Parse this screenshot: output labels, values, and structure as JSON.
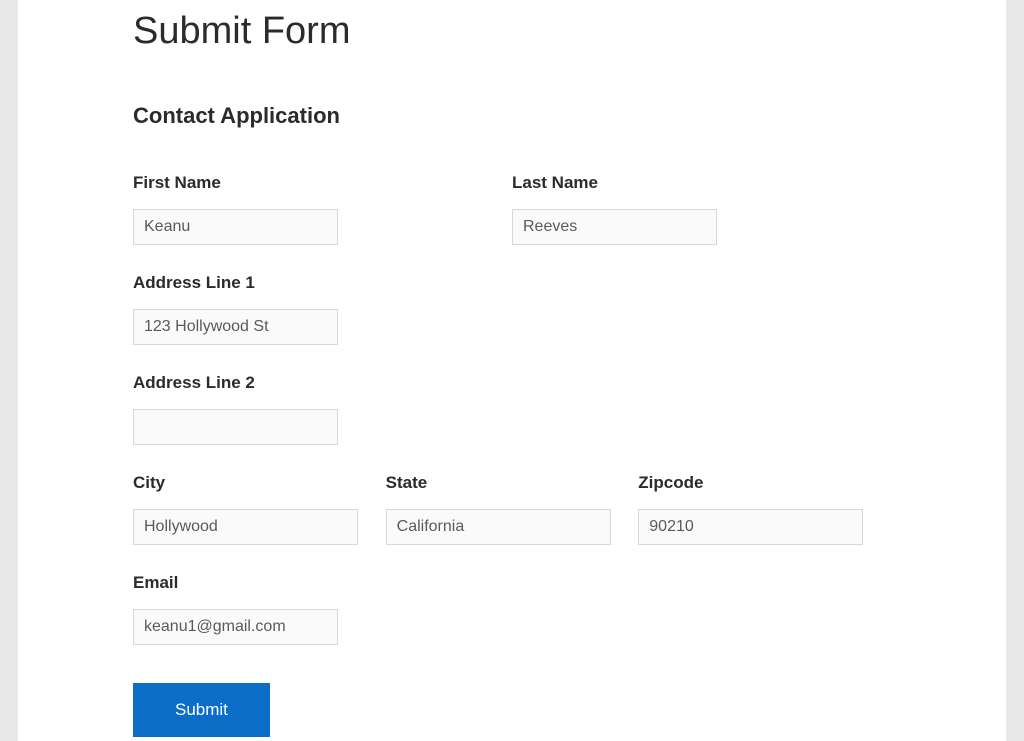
{
  "page": {
    "title": "Submit Form",
    "section_title": "Contact Application"
  },
  "form": {
    "first_name": {
      "label": "First Name",
      "value": "Keanu"
    },
    "last_name": {
      "label": "Last Name",
      "value": "Reeves"
    },
    "address_line_1": {
      "label": "Address Line 1",
      "value": "123 Hollywood St"
    },
    "address_line_2": {
      "label": "Address Line 2",
      "value": ""
    },
    "city": {
      "label": "City",
      "value": "Hollywood"
    },
    "state": {
      "label": "State",
      "value": "California"
    },
    "zipcode": {
      "label": "Zipcode",
      "value": "90210"
    },
    "email": {
      "label": "Email",
      "value": "keanu1@gmail.com"
    },
    "submit_label": "Submit"
  }
}
